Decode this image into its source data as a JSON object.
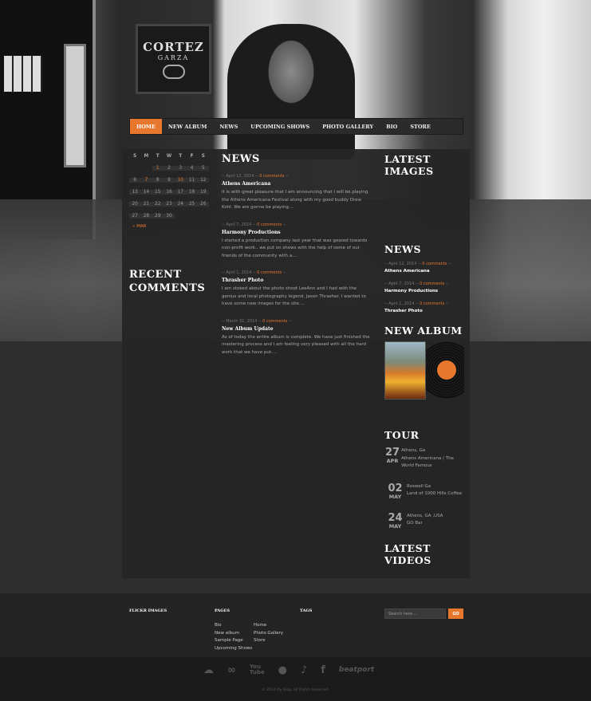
{
  "logo": {
    "line1": "CORTEZ",
    "line2": "GARZA"
  },
  "nav": {
    "items": [
      "HOME",
      "NEW ALBUM",
      "NEWS",
      "UPCOMING SHOWS",
      "PHOTO GALLERY",
      "BIO",
      "STORE"
    ]
  },
  "calendar": {
    "weekdays": [
      "S",
      "M",
      "T",
      "W",
      "T",
      "F",
      "S"
    ],
    "weeks": [
      [
        "",
        "",
        "1",
        "2",
        "3",
        "4",
        "5"
      ],
      [
        "6",
        "7",
        "8",
        "9",
        "10",
        "11",
        "12"
      ],
      [
        "13",
        "14",
        "15",
        "16",
        "17",
        "18",
        "19"
      ],
      [
        "20",
        "21",
        "22",
        "23",
        "24",
        "25",
        "26"
      ],
      [
        "27",
        "28",
        "29",
        "30",
        "",
        "",
        ""
      ]
    ],
    "prev": "« MAR"
  },
  "recent_comments": {
    "heading": "RECENT COMMENTS"
  },
  "news": {
    "heading": "NEWS",
    "posts": [
      {
        "date": "April 12, 2014",
        "comments": "0 comments",
        "title": "Athens Americana",
        "excerpt": "It is with great pleasure that I am announcing that I will be playing the Athens Americana Festival along with my good buddy Drew Kohl. We are gonna be playing...."
      },
      {
        "date": "April 7, 2014",
        "comments": "0 comments",
        "title": "Harmony Productions",
        "excerpt": "I started a production company last year that was geared towards non-profit work.. we put on shows with the help of some of our friends of the community with a...."
      },
      {
        "date": "April 1, 2014",
        "comments": "0 comments",
        "title": "Thrasher Photo",
        "excerpt": "I am stoked about the photo shoot LeeAnn and I had with the genius and local photography legend, Jason Thrasher. I wanted to have some new images for the site...."
      },
      {
        "date": "March 31, 2014",
        "comments": "0 comments",
        "title": "New Album Update",
        "excerpt": "As of today the entire album is complete. We have just finished the mastering process and I am feeling very pleased with all the hard work that we have put...."
      }
    ]
  },
  "sidebar": {
    "latest_images": "LATEST IMAGES",
    "news_heading": "NEWS",
    "news": [
      {
        "date": "April 12, 2014",
        "comments": "0 comments",
        "title": "Athens Americana"
      },
      {
        "date": "April 7, 2014",
        "comments": "0 comments",
        "title": "Harmony Productions"
      },
      {
        "date": "April 1, 2014",
        "comments": "0 comments",
        "title": "Thrasher Photo"
      }
    ],
    "new_album": "NEW ALBUM",
    "tour_heading": "TOUR",
    "tour": [
      {
        "day": "27",
        "month": "APR",
        "place": "Athens, Ga",
        "venue": "Athens Americana / The World Famous"
      },
      {
        "day": "02",
        "month": "MAY",
        "place": "Roswell Ga",
        "venue": "Land of 1000 Hills Coffee"
      },
      {
        "day": "24",
        "month": "MAY",
        "place": "Athens, GA ,USA",
        "venue": "GO Bar"
      }
    ],
    "latest_videos": "LATEST VIDEOS"
  },
  "footer": {
    "flickr": "FLICKR IMAGES",
    "pages_heading": "PAGES",
    "tags_heading": "TAGS",
    "pages_col1": [
      "Bio",
      "New album",
      "Sample Page",
      "Upcoming Shows"
    ],
    "pages_col2": [
      "Home",
      "Photo Gallery",
      "Store"
    ],
    "search_placeholder": "Search here ...",
    "go": "GO",
    "copyright": "© 2014 My Blog. All Rights Reserved."
  },
  "social": {
    "icons": [
      "soundcloud-icon",
      "lastfm-icon",
      "youtube-icon",
      "apple-icon",
      "twitter-icon",
      "facebook-icon",
      "beatport-icon"
    ],
    "youtube": "You\nTube",
    "beatport": "beatport"
  },
  "colors": {
    "accent": "#e8772e",
    "background": "#2e2e2e",
    "panel": "#252525"
  }
}
